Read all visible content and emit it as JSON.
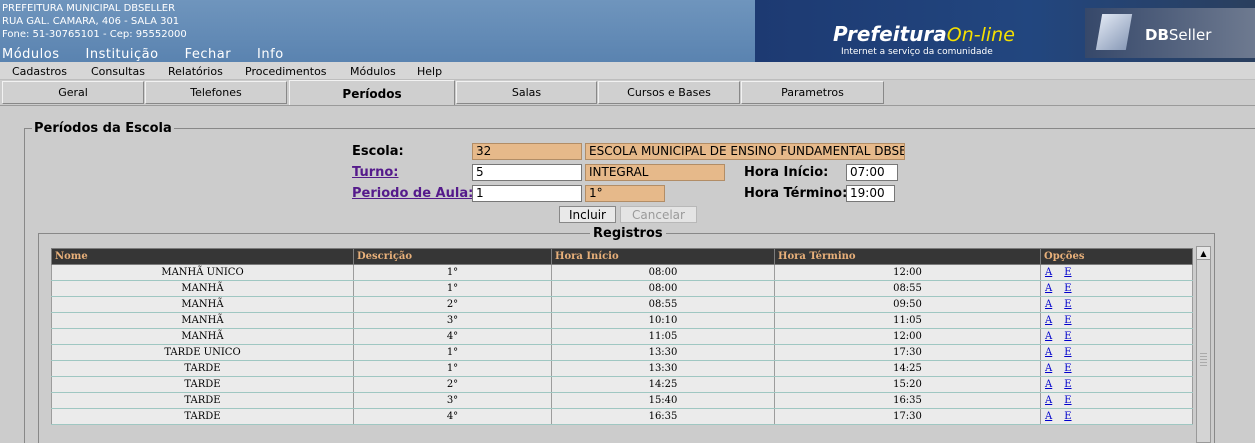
{
  "header": {
    "org_name": "PREFEITURA MUNICIPAL DBSELLER",
    "address": "RUA GAL. CAMARA, 406 - SALA 301",
    "phone": "Fone: 51-30765101  -  Cep: 95552000",
    "nav": [
      "Módulos",
      "Instituição",
      "Fechar",
      "Info"
    ],
    "logo_prefeitura": "Prefeitura",
    "logo_online": "On-line",
    "logo_tagline": "Internet a serviço da comunidade",
    "logo_db": "DB",
    "logo_seller": "Seller"
  },
  "menu": [
    "Cadastros",
    "Consultas",
    "Relatórios",
    "Procedimentos",
    "Módulos",
    "Help"
  ],
  "tabs": [
    "Geral",
    "Telefones",
    "Períodos",
    "Salas",
    "Cursos e Bases",
    "Parametros"
  ],
  "active_tab": "Períodos",
  "form": {
    "legend": "Períodos da Escola",
    "escola_label": "Escola:",
    "escola_code": "32",
    "escola_name": "ESCOLA MUNICIPAL DE ENSINO FUNDAMENTAL DBSEI",
    "turno_label": "Turno:",
    "turno_code": "5",
    "turno_name": "INTEGRAL",
    "periodo_label": "Periodo de Aula:",
    "periodo_code": "1",
    "periodo_name": "1°",
    "hora_inicio_label": "Hora Início:",
    "hora_inicio": "07:00",
    "hora_termino_label": "Hora Término:",
    "hora_termino": "19:00",
    "incluir_label": "Incluir",
    "cancelar_label": "Cancelar"
  },
  "registros": {
    "legend": "Registros",
    "columns": [
      "Nome",
      "Descrição",
      "Hora Início",
      "Hora Término",
      "Opções"
    ],
    "rows": [
      [
        "MANHÃ UNICO",
        "1°",
        "08:00",
        "12:00"
      ],
      [
        "MANHÃ",
        "1°",
        "08:00",
        "08:55"
      ],
      [
        "MANHÃ",
        "2°",
        "08:55",
        "09:50"
      ],
      [
        "MANHÃ",
        "3°",
        "10:10",
        "11:05"
      ],
      [
        "MANHÃ",
        "4°",
        "11:05",
        "12:00"
      ],
      [
        "TARDE UNICO",
        "1°",
        "13:30",
        "17:30"
      ],
      [
        "TARDE",
        "1°",
        "13:30",
        "14:25"
      ],
      [
        "TARDE",
        "2°",
        "14:25",
        "15:20"
      ],
      [
        "TARDE",
        "3°",
        "15:40",
        "16:35"
      ],
      [
        "TARDE",
        "4°",
        "16:35",
        "17:30"
      ]
    ],
    "opt_alter": "A",
    "opt_exclude": "E"
  },
  "colors": {
    "header_bg": "#5a83b0",
    "readonly_input": "#e6b98a",
    "grid_header_bg": "#363636",
    "grid_header_text": "#e8b07a",
    "link": "#551a8b"
  }
}
